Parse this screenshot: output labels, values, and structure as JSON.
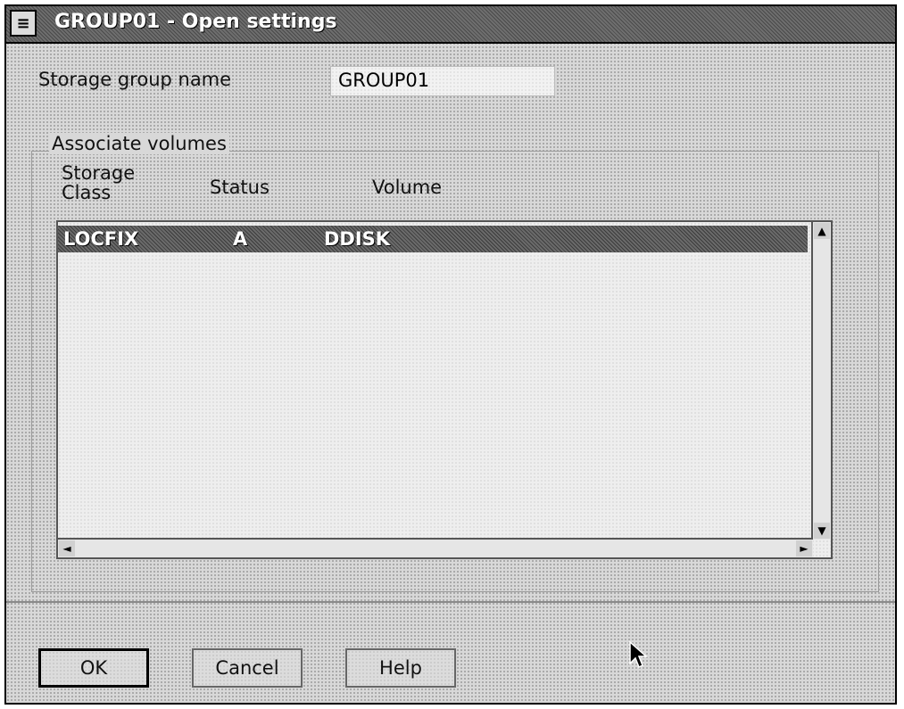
{
  "window": {
    "title": "GROUP01 - Open settings",
    "system_menu_glyph": "≡"
  },
  "form": {
    "storage_group_label": "Storage group name",
    "storage_group_value": "GROUP01"
  },
  "associate_volumes": {
    "group_label": "Associate volumes",
    "columns": {
      "storage_class_line1": "Storage",
      "storage_class_line2": "Class",
      "status": "Status",
      "volume": "Volume"
    },
    "rows": [
      {
        "storage_class": "LOCFIX",
        "status": "A",
        "volume": "DDISK"
      }
    ]
  },
  "scrollbar": {
    "up_glyph": "▲",
    "down_glyph": "▼",
    "left_glyph": "◄",
    "right_glyph": "►"
  },
  "buttons": {
    "ok": "OK",
    "cancel": "Cancel",
    "help": "Help"
  },
  "icons": {
    "system_menu": "system-menu-icon",
    "mouse_pointer": "mouse-pointer-icon"
  }
}
